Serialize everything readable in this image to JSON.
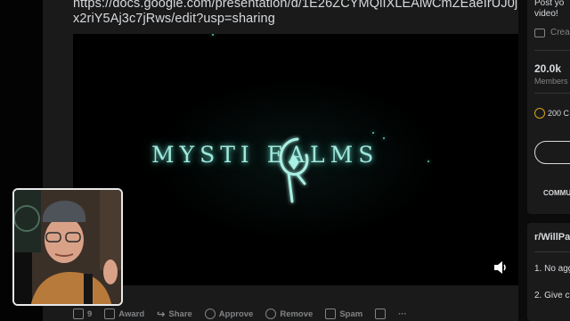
{
  "post": {
    "link_text": "https://docs.google.com/presentation/d/1E26ZCYMQlIXLEAlwCmZEaeIrUJ0jx2riY5Aj3c7jRws/edit?usp=sharing"
  },
  "video": {
    "logo_text": "MYSTI   EALMS",
    "volume_icon": "speaker-icon"
  },
  "actions": [
    {
      "label": "9",
      "icon": "comment-icon"
    },
    {
      "label": "Award",
      "icon": "award-icon"
    },
    {
      "label": "Share",
      "icon": "share-icon"
    },
    {
      "label": "Approve",
      "icon": "check-circle-icon"
    },
    {
      "label": "Remove",
      "icon": "ban-icon"
    },
    {
      "label": "Spam",
      "icon": "spam-icon"
    },
    {
      "label": "",
      "icon": "shield-icon"
    },
    {
      "label": "···",
      "icon": "more-icon"
    }
  ],
  "sidebar": {
    "post_text_line1": "Post yo",
    "post_text_line2": "video!",
    "create_label": "Crea",
    "members_count": "20.0k",
    "members_label": "Members",
    "coins_label": "200 C",
    "community_label": "COMMU",
    "rules_title": "r/WillPa",
    "rule1": "1. No agg",
    "rule2": "2. Give c"
  },
  "colors": {
    "accent_teal": "#9fe8dd",
    "page_bg": "#0b0b0c",
    "card_bg": "#1a1a1b",
    "muted_text": "#818384"
  }
}
